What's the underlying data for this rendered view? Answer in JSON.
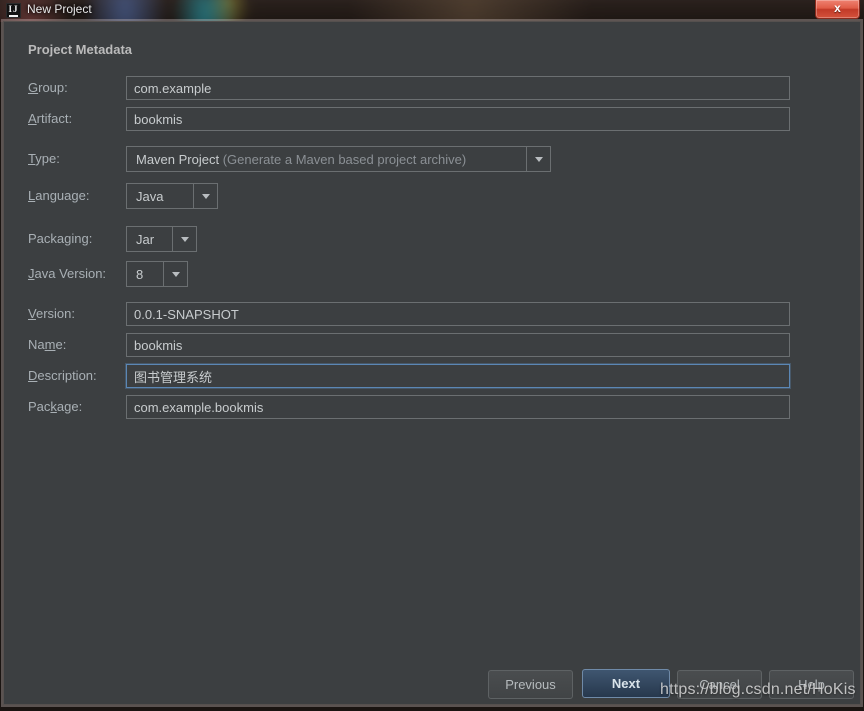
{
  "window": {
    "title": "New Project",
    "app_icon": "intellij-idea-icon",
    "close_label": "x"
  },
  "dialog": {
    "section_title": "Project Metadata",
    "fields": [
      {
        "id": "group",
        "label": "Group:",
        "mnemonic": "G",
        "value": "com.example",
        "type": "text",
        "focused": false
      },
      {
        "id": "artifact",
        "label": "Artifact:",
        "mnemonic": "A",
        "value": "bookmis",
        "type": "text",
        "focused": false
      },
      {
        "id": "version",
        "label": "Version:",
        "mnemonic": "V",
        "value": "0.0.1-SNAPSHOT",
        "type": "text",
        "focused": false
      },
      {
        "id": "name",
        "label": "Name:",
        "mnemonic": "m",
        "value": "bookmis",
        "type": "text",
        "focused": false
      },
      {
        "id": "description",
        "label": "Description:",
        "mnemonic": "D",
        "value": "图书管理系统",
        "type": "text",
        "focused": true
      },
      {
        "id": "package",
        "label": "Package:",
        "mnemonic": "k",
        "value": "com.example.bookmis",
        "type": "text",
        "focused": false
      }
    ],
    "combos": [
      {
        "id": "type",
        "label": "Type:",
        "mnemonic": "T",
        "value": "Maven Project",
        "value_hint": " (Generate a Maven based project archive)"
      },
      {
        "id": "language",
        "label": "Language:",
        "mnemonic": "L",
        "value": "Java",
        "value_hint": ""
      },
      {
        "id": "packaging",
        "label": "Packaging:",
        "mnemonic": "g",
        "value": "Jar",
        "value_hint": ""
      },
      {
        "id": "java_version",
        "label": "Java Version:",
        "mnemonic": "J",
        "value": "8",
        "value_hint": ""
      }
    ]
  },
  "buttons": {
    "previous": "Previous",
    "next": "Next",
    "cancel": "Cancel",
    "help": "Help"
  },
  "watermark": "https://blog.csdn.net/HoKis",
  "colors": {
    "panel_bg": "#3c3f41",
    "field_border": "#6b6f71",
    "focus_border": "#5b87b5",
    "label_text": "#a9b0b5",
    "value_text": "#c8ccce",
    "hint_text": "#8b9095",
    "default_button": "#3f5670",
    "close_button": "#e05c47"
  }
}
